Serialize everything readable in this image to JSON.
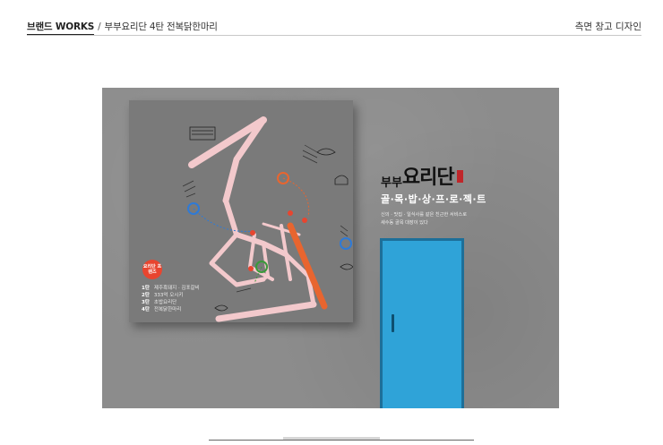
{
  "header": {
    "brand": "브랜드 WORKS",
    "separator": "/",
    "project": "부부요리단 4탄 전복닭한마리",
    "page_label": "측면 창고 디자인"
  },
  "poster": {
    "badge": "요리단 프렌즈",
    "legend": [
      {
        "no": "1탄",
        "text": "제주흑돼지 · 김포갈비"
      },
      {
        "no": "2탄",
        "text": "333억 오시키"
      },
      {
        "no": "3탄",
        "text": "초밥요리단"
      },
      {
        "no": "4탄",
        "text": "전복닭한마리"
      }
    ]
  },
  "brand_block": {
    "logo_small": "부부",
    "logo_big": "요리단",
    "project_title": "골·목·밥·상·프·로·젝·트",
    "desc_line1": "신의 · 맛집 · 일식사를 같은 친근한 서비스로",
    "desc_line2": "새수동 골목 대장이 있다"
  },
  "colors": {
    "wall": "#8c8c8c",
    "poster": "#7a7a7a",
    "road": "#f3c9cc",
    "accent_red": "#e8452f",
    "door": "#2fa3d8",
    "door_frame": "#1d6f99"
  }
}
